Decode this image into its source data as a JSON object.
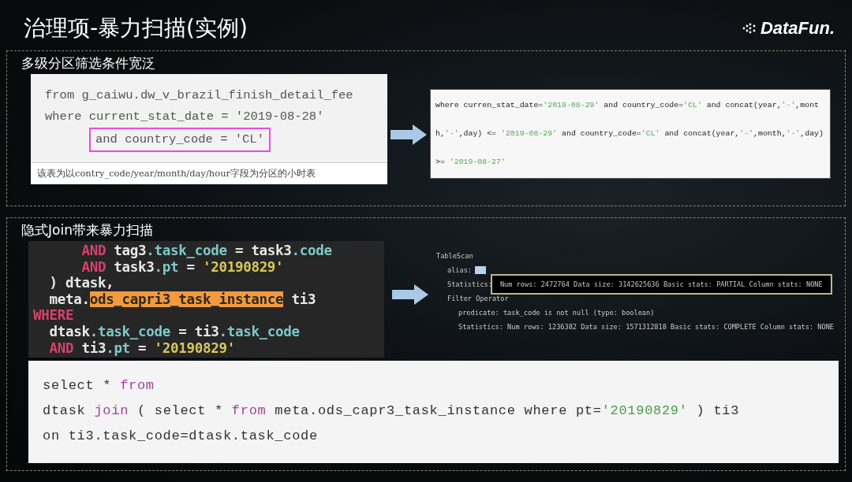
{
  "title": "治理项-暴力扫描(实例)",
  "logo": {
    "text": "DataFun."
  },
  "sections": [
    {
      "heading": "多级分区筛选条件宽泛",
      "source": {
        "lines": [
          {
            "boxed": false,
            "tokens": [
              {
                "kind": "plain",
                "t": "from g_caiwu.dw_v_brazil_finish_detail_fee"
              }
            ]
          },
          {
            "boxed": false,
            "tokens": [
              {
                "kind": "plain",
                "t": "where current_stat_date = '2019-08-28'"
              }
            ]
          },
          {
            "boxed": true,
            "tokens": [
              {
                "kind": "plain",
                "t": "and country_code = 'CL'"
              }
            ]
          }
        ],
        "caption": "该表为以contry_code/year/month/day/hour字段为分区的小时表"
      },
      "result": {
        "lines": [
          {
            "tokens": [
              {
                "kind": "plain",
                "t": "where curren_stat_date="
              },
              {
                "kind": "str",
                "t": "'2019-08-29'"
              },
              {
                "kind": "plain",
                "t": " and country_code="
              },
              {
                "kind": "str",
                "t": "'CL'"
              },
              {
                "kind": "plain",
                "t": " and concat(year,"
              },
              {
                "kind": "str",
                "t": "'-'"
              },
              {
                "kind": "plain",
                "t": ",mont"
              }
            ]
          },
          {
            "tokens": [
              {
                "kind": "plain",
                "t": "h,"
              },
              {
                "kind": "str",
                "t": "'-'"
              },
              {
                "kind": "plain",
                "t": ",day) <= "
              },
              {
                "kind": "str",
                "t": "'2019-08-29'"
              },
              {
                "kind": "plain",
                "t": " and country_code="
              },
              {
                "kind": "str",
                "t": "'CL'"
              },
              {
                "kind": "plain",
                "t": " and concat(year,"
              },
              {
                "kind": "str",
                "t": "'-'"
              },
              {
                "kind": "plain",
                "t": ",month,"
              },
              {
                "kind": "str",
                "t": "'-'"
              },
              {
                "kind": "plain",
                "t": ",day)"
              }
            ]
          },
          {
            "tokens": [
              {
                "kind": "plain",
                "t": ">= "
              },
              {
                "kind": "str",
                "t": "'2019-08-27'"
              }
            ]
          }
        ]
      }
    },
    {
      "heading": "隐式Join带来暴力扫描",
      "source": {
        "lines": [
          {
            "tokens": [
              {
                "kind": "kw",
                "t": "      AND"
              },
              {
                "kind": "plain",
                "t": " tag3"
              },
              {
                "kind": "field",
                "t": ".task_code"
              },
              {
                "kind": "plain",
                "t": " = task3"
              },
              {
                "kind": "field",
                "t": ".code"
              }
            ]
          },
          {
            "tokens": [
              {
                "kind": "kw",
                "t": "      AND"
              },
              {
                "kind": "plain",
                "t": " task3"
              },
              {
                "kind": "field",
                "t": ".pt"
              },
              {
                "kind": "plain",
                "t": " = "
              },
              {
                "kind": "str",
                "t": "'20190829'"
              }
            ]
          },
          {
            "tokens": [
              {
                "kind": "plain",
                "t": "  ) dtask,"
              }
            ]
          },
          {
            "tokens": [
              {
                "kind": "plain",
                "t": "  meta."
              },
              {
                "kind": "hl",
                "t": "ods_capri3_task_instance"
              },
              {
                "kind": "plain",
                "t": " ti3"
              }
            ]
          },
          {
            "tokens": [
              {
                "kind": "kw",
                "t": "WHERE"
              }
            ]
          },
          {
            "tokens": [
              {
                "kind": "plain",
                "t": "  dtask"
              },
              {
                "kind": "field",
                "t": ".task_code"
              },
              {
                "kind": "plain",
                "t": " = ti3"
              },
              {
                "kind": "field",
                "t": ".task_code"
              }
            ]
          },
          {
            "tokens": [
              {
                "kind": "kw",
                "t": "  AND"
              },
              {
                "kind": "plain",
                "t": " ti3"
              },
              {
                "kind": "field",
                "t": ".pt"
              },
              {
                "kind": "plain",
                "t": " = "
              },
              {
                "kind": "str",
                "t": "'20190829'"
              }
            ]
          }
        ]
      },
      "plan": [
        {
          "text": "TableScan",
          "children": [
            {
              "text": "alias:",
              "highlight": true
            },
            {
              "text": "Statistics:",
              "note": "Num rows: 2472764 Data size: 3142625636 Basic stats: PARTIAL Column stats: NONE",
              "boxed": true
            },
            {
              "text": "Filter Operator",
              "children": [
                {
                  "text": "predicate: task_code is not null (type: boolean)"
                },
                {
                  "text": "Statistics: Num rows: 1236382 Data size: 1571312818 Basic stats: COMPLETE Column stats: NONE"
                }
              ]
            }
          ]
        }
      ],
      "fix": {
        "lines": [
          {
            "tokens": [
              {
                "kind": "plain",
                "t": "select * "
              },
              {
                "kind": "kw",
                "t": "from"
              }
            ]
          },
          {
            "tokens": [
              {
                "kind": "plain",
                "t": "dtask "
              },
              {
                "kind": "kw",
                "t": "join"
              },
              {
                "kind": "plain",
                "t": " ( select * "
              },
              {
                "kind": "kw",
                "t": "from"
              },
              {
                "kind": "plain",
                "t": " meta.ods_capr3_task_instance where pt="
              },
              {
                "kind": "str",
                "t": "'20190829'"
              },
              {
                "kind": "plain",
                "t": " ) ti3"
              }
            ]
          },
          {
            "tokens": [
              {
                "kind": "plain",
                "t": "on ti3.task_code=dtask.task_code"
              }
            ]
          }
        ]
      }
    }
  ]
}
